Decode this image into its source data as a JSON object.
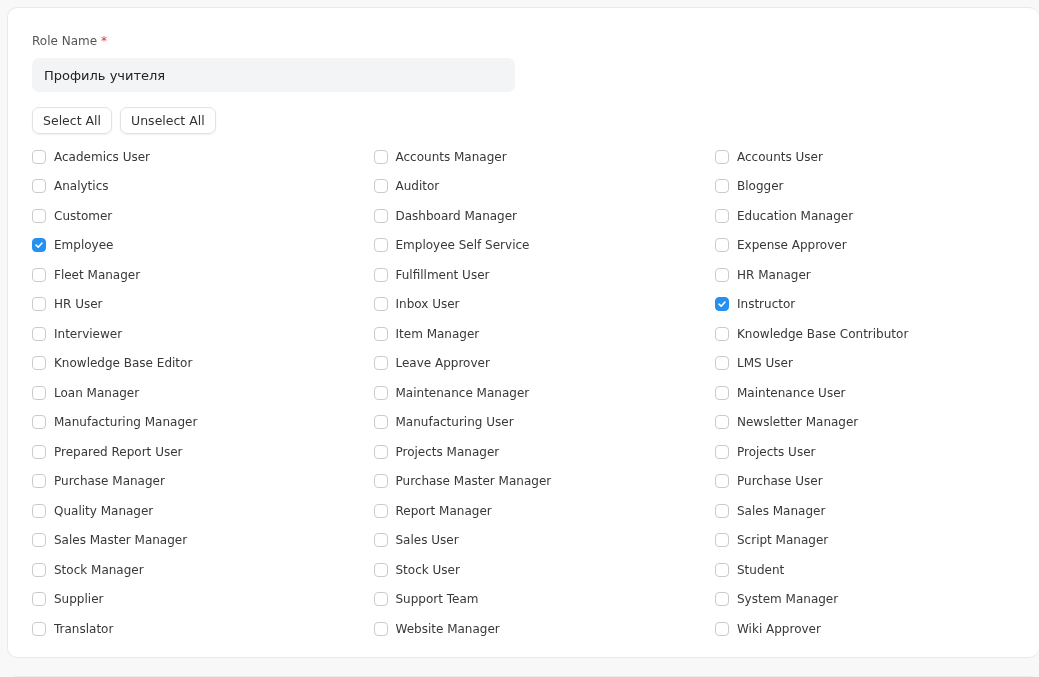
{
  "role_name": {
    "label": "Role Name",
    "required_mark": "*",
    "value": "Профиль учителя"
  },
  "buttons": [
    "Select All",
    "Unselect All"
  ],
  "roles": [
    {
      "label": "Academics User",
      "checked": false
    },
    {
      "label": "Accounts Manager",
      "checked": false
    },
    {
      "label": "Accounts User",
      "checked": false
    },
    {
      "label": "Analytics",
      "checked": false
    },
    {
      "label": "Auditor",
      "checked": false
    },
    {
      "label": "Blogger",
      "checked": false
    },
    {
      "label": "Customer",
      "checked": false
    },
    {
      "label": "Dashboard Manager",
      "checked": false
    },
    {
      "label": "Education Manager",
      "checked": false
    },
    {
      "label": "Employee",
      "checked": true
    },
    {
      "label": "Employee Self Service",
      "checked": false
    },
    {
      "label": "Expense Approver",
      "checked": false
    },
    {
      "label": "Fleet Manager",
      "checked": false
    },
    {
      "label": "Fulfillment User",
      "checked": false
    },
    {
      "label": "HR Manager",
      "checked": false
    },
    {
      "label": "HR User",
      "checked": false
    },
    {
      "label": "Inbox User",
      "checked": false
    },
    {
      "label": "Instructor",
      "checked": true
    },
    {
      "label": "Interviewer",
      "checked": false
    },
    {
      "label": "Item Manager",
      "checked": false
    },
    {
      "label": "Knowledge Base Contributor",
      "checked": false
    },
    {
      "label": "Knowledge Base Editor",
      "checked": false
    },
    {
      "label": "Leave Approver",
      "checked": false
    },
    {
      "label": "LMS User",
      "checked": false
    },
    {
      "label": "Loan Manager",
      "checked": false
    },
    {
      "label": "Maintenance Manager",
      "checked": false
    },
    {
      "label": "Maintenance User",
      "checked": false
    },
    {
      "label": "Manufacturing Manager",
      "checked": false
    },
    {
      "label": "Manufacturing User",
      "checked": false
    },
    {
      "label": "Newsletter Manager",
      "checked": false
    },
    {
      "label": "Prepared Report User",
      "checked": false
    },
    {
      "label": "Projects Manager",
      "checked": false
    },
    {
      "label": "Projects User",
      "checked": false
    },
    {
      "label": "Purchase Manager",
      "checked": false
    },
    {
      "label": "Purchase Master Manager",
      "checked": false
    },
    {
      "label": "Purchase User",
      "checked": false
    },
    {
      "label": "Quality Manager",
      "checked": false
    },
    {
      "label": "Report Manager",
      "checked": false
    },
    {
      "label": "Sales Manager",
      "checked": false
    },
    {
      "label": "Sales Master Manager",
      "checked": false
    },
    {
      "label": "Sales User",
      "checked": false
    },
    {
      "label": "Script Manager",
      "checked": false
    },
    {
      "label": "Stock Manager",
      "checked": false
    },
    {
      "label": "Stock User",
      "checked": false
    },
    {
      "label": "Student",
      "checked": false
    },
    {
      "label": "Supplier",
      "checked": false
    },
    {
      "label": "Support Team",
      "checked": false
    },
    {
      "label": "System Manager",
      "checked": false
    },
    {
      "label": "Translator",
      "checked": false
    },
    {
      "label": "Website Manager",
      "checked": false
    },
    {
      "label": "Wiki Approver",
      "checked": false
    }
  ]
}
